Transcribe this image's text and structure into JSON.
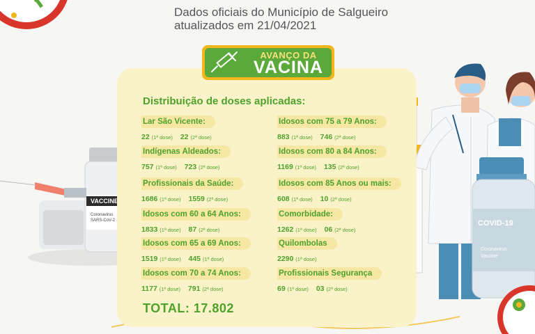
{
  "header": {
    "line1": "Dados oficiais do Município de Salgueiro",
    "line2": "atualizados em 21/04/2021"
  },
  "badge": {
    "line1": "AVANÇO DA",
    "line2": "VACINA",
    "icon": "syringe-icon"
  },
  "panel": {
    "title": "Distribuição de doses aplicadas:",
    "total": "TOTAL: 17.802",
    "left_column": [
      {
        "label": "Lar São Vicente:",
        "d1": "22",
        "d1_tag": "(1ª dose)",
        "d2": "22",
        "d2_tag": "(2ª dose)"
      },
      {
        "label": "Indígenas Aldeados:",
        "d1": "757",
        "d1_tag": "(1ª dose)",
        "d2": "723",
        "d2_tag": "(2ª dose)"
      },
      {
        "label": "Profissionais da Saúde:",
        "d1": "1686",
        "d1_tag": "(1ª dose)",
        "d2": "1559",
        "d2_tag": "(2ª dose)"
      },
      {
        "label": "Idosos com 60 a 64 Anos:",
        "d1": "1833",
        "d1_tag": "(1ª dose)",
        "d2": "87",
        "d2_tag": "(2ª dose)"
      },
      {
        "label": "Idosos com 65 a 69 Anos:",
        "d1": "1519",
        "d1_tag": "(1ª dose)",
        "d2": "445",
        "d2_tag": "(1ª dose)"
      },
      {
        "label": "Idosos com 70 a 74 Anos:",
        "d1": "1177",
        "d1_tag": "(1ª dose)",
        "d2": "791",
        "d2_tag": "(2ª dose)"
      }
    ],
    "right_column": [
      {
        "label": "Idosos com 75 a 79 Anos:",
        "d1": "883",
        "d1_tag": "(1ª dose)",
        "d2": "746",
        "d2_tag": "(2ª dose)"
      },
      {
        "label": "Idosos com 80 a 84 Anos:",
        "d1": "1169",
        "d1_tag": "(1ª dose)",
        "d2": "135",
        "d2_tag": "(2ª dose)"
      },
      {
        "label": "Idosos com 85 Anos ou mais:",
        "d1": "608",
        "d1_tag": "(1ª dose)",
        "d2": "10",
        "d2_tag": "(2ª dose)"
      },
      {
        "label": "Comorbidade:",
        "d1": "1262",
        "d1_tag": "(1ª dose)",
        "d2": "06",
        "d2_tag": "(2ª dose)"
      },
      {
        "label": "Quilombolas",
        "d1": "2290",
        "d1_tag": "(1ª dose)",
        "d2": "",
        "d2_tag": ""
      },
      {
        "label": "Profissionais Segurança",
        "d1": "69",
        "d1_tag": "(1ª dose)",
        "d2": "03",
        "d2_tag": "(2ª dose)"
      }
    ]
  },
  "illustration": {
    "vial_label_brand": "VACCINE",
    "vial_label_sub1": "Coronavirus",
    "vial_label_sub2": "SARS-CoV-2",
    "right_vial_title": "COVID-19",
    "right_vial_sub1": "Coronavirus",
    "right_vial_sub2": "Vaccine"
  },
  "colors": {
    "green": "#4ea12b",
    "badge_green": "#5aa93a",
    "badge_yellow": "#f2b51c",
    "panel": "#faf3c9",
    "label_bg": "#f6e8a4",
    "red_clock": "#d9362b"
  }
}
